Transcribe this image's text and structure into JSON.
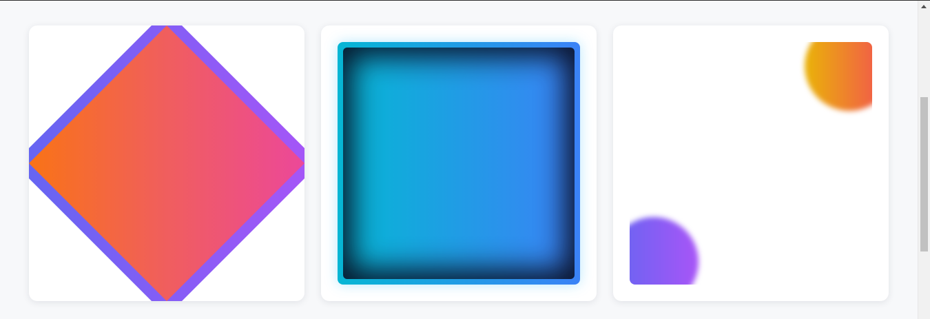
{
  "page": {
    "background": "#f7f8fa"
  },
  "cards": [
    {
      "kind": "diamond",
      "fill_gradient": [
        "#f97316",
        "#f05e5e",
        "#ec4899"
      ],
      "border_gradient": [
        "#6366f1",
        "#a855f7"
      ]
    },
    {
      "kind": "inset-square",
      "fill_gradient": [
        "#06b6d4",
        "#3b82f6"
      ],
      "inset_shadow_color": "#080f23"
    },
    {
      "kind": "blurred-circles",
      "top_circle_gradient": [
        "#eab308",
        "#f43f5e"
      ],
      "bottom_circle_gradient": [
        "#6366f1",
        "#a855f7"
      ]
    }
  ],
  "scrollbar": {
    "icons": [
      "scroll-up-arrow-icon"
    ]
  }
}
